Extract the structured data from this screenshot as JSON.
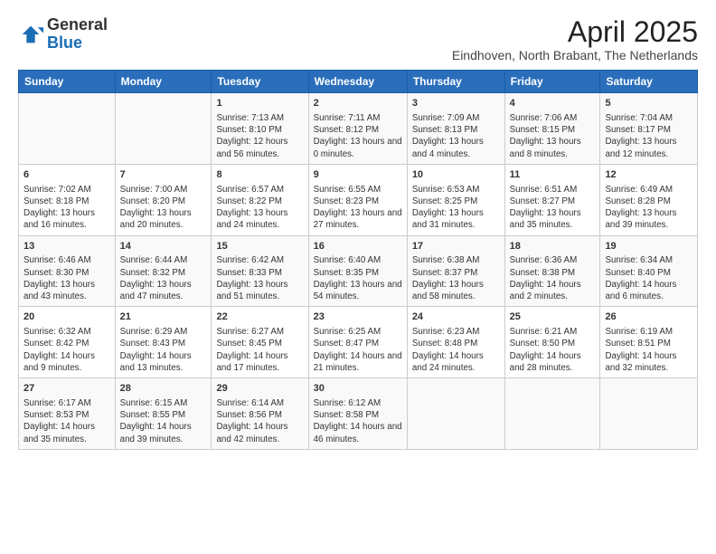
{
  "logo": {
    "general": "General",
    "blue": "Blue"
  },
  "title": "April 2025",
  "subtitle": "Eindhoven, North Brabant, The Netherlands",
  "days_header": [
    "Sunday",
    "Monday",
    "Tuesday",
    "Wednesday",
    "Thursday",
    "Friday",
    "Saturday"
  ],
  "weeks": [
    [
      {
        "day": "",
        "info": ""
      },
      {
        "day": "",
        "info": ""
      },
      {
        "day": "1",
        "info": "Sunrise: 7:13 AM\nSunset: 8:10 PM\nDaylight: 12 hours and 56 minutes."
      },
      {
        "day": "2",
        "info": "Sunrise: 7:11 AM\nSunset: 8:12 PM\nDaylight: 13 hours and 0 minutes."
      },
      {
        "day": "3",
        "info": "Sunrise: 7:09 AM\nSunset: 8:13 PM\nDaylight: 13 hours and 4 minutes."
      },
      {
        "day": "4",
        "info": "Sunrise: 7:06 AM\nSunset: 8:15 PM\nDaylight: 13 hours and 8 minutes."
      },
      {
        "day": "5",
        "info": "Sunrise: 7:04 AM\nSunset: 8:17 PM\nDaylight: 13 hours and 12 minutes."
      }
    ],
    [
      {
        "day": "6",
        "info": "Sunrise: 7:02 AM\nSunset: 8:18 PM\nDaylight: 13 hours and 16 minutes."
      },
      {
        "day": "7",
        "info": "Sunrise: 7:00 AM\nSunset: 8:20 PM\nDaylight: 13 hours and 20 minutes."
      },
      {
        "day": "8",
        "info": "Sunrise: 6:57 AM\nSunset: 8:22 PM\nDaylight: 13 hours and 24 minutes."
      },
      {
        "day": "9",
        "info": "Sunrise: 6:55 AM\nSunset: 8:23 PM\nDaylight: 13 hours and 27 minutes."
      },
      {
        "day": "10",
        "info": "Sunrise: 6:53 AM\nSunset: 8:25 PM\nDaylight: 13 hours and 31 minutes."
      },
      {
        "day": "11",
        "info": "Sunrise: 6:51 AM\nSunset: 8:27 PM\nDaylight: 13 hours and 35 minutes."
      },
      {
        "day": "12",
        "info": "Sunrise: 6:49 AM\nSunset: 8:28 PM\nDaylight: 13 hours and 39 minutes."
      }
    ],
    [
      {
        "day": "13",
        "info": "Sunrise: 6:46 AM\nSunset: 8:30 PM\nDaylight: 13 hours and 43 minutes."
      },
      {
        "day": "14",
        "info": "Sunrise: 6:44 AM\nSunset: 8:32 PM\nDaylight: 13 hours and 47 minutes."
      },
      {
        "day": "15",
        "info": "Sunrise: 6:42 AM\nSunset: 8:33 PM\nDaylight: 13 hours and 51 minutes."
      },
      {
        "day": "16",
        "info": "Sunrise: 6:40 AM\nSunset: 8:35 PM\nDaylight: 13 hours and 54 minutes."
      },
      {
        "day": "17",
        "info": "Sunrise: 6:38 AM\nSunset: 8:37 PM\nDaylight: 13 hours and 58 minutes."
      },
      {
        "day": "18",
        "info": "Sunrise: 6:36 AM\nSunset: 8:38 PM\nDaylight: 14 hours and 2 minutes."
      },
      {
        "day": "19",
        "info": "Sunrise: 6:34 AM\nSunset: 8:40 PM\nDaylight: 14 hours and 6 minutes."
      }
    ],
    [
      {
        "day": "20",
        "info": "Sunrise: 6:32 AM\nSunset: 8:42 PM\nDaylight: 14 hours and 9 minutes."
      },
      {
        "day": "21",
        "info": "Sunrise: 6:29 AM\nSunset: 8:43 PM\nDaylight: 14 hours and 13 minutes."
      },
      {
        "day": "22",
        "info": "Sunrise: 6:27 AM\nSunset: 8:45 PM\nDaylight: 14 hours and 17 minutes."
      },
      {
        "day": "23",
        "info": "Sunrise: 6:25 AM\nSunset: 8:47 PM\nDaylight: 14 hours and 21 minutes."
      },
      {
        "day": "24",
        "info": "Sunrise: 6:23 AM\nSunset: 8:48 PM\nDaylight: 14 hours and 24 minutes."
      },
      {
        "day": "25",
        "info": "Sunrise: 6:21 AM\nSunset: 8:50 PM\nDaylight: 14 hours and 28 minutes."
      },
      {
        "day": "26",
        "info": "Sunrise: 6:19 AM\nSunset: 8:51 PM\nDaylight: 14 hours and 32 minutes."
      }
    ],
    [
      {
        "day": "27",
        "info": "Sunrise: 6:17 AM\nSunset: 8:53 PM\nDaylight: 14 hours and 35 minutes."
      },
      {
        "day": "28",
        "info": "Sunrise: 6:15 AM\nSunset: 8:55 PM\nDaylight: 14 hours and 39 minutes."
      },
      {
        "day": "29",
        "info": "Sunrise: 6:14 AM\nSunset: 8:56 PM\nDaylight: 14 hours and 42 minutes."
      },
      {
        "day": "30",
        "info": "Sunrise: 6:12 AM\nSunset: 8:58 PM\nDaylight: 14 hours and 46 minutes."
      },
      {
        "day": "",
        "info": ""
      },
      {
        "day": "",
        "info": ""
      },
      {
        "day": "",
        "info": ""
      }
    ]
  ]
}
